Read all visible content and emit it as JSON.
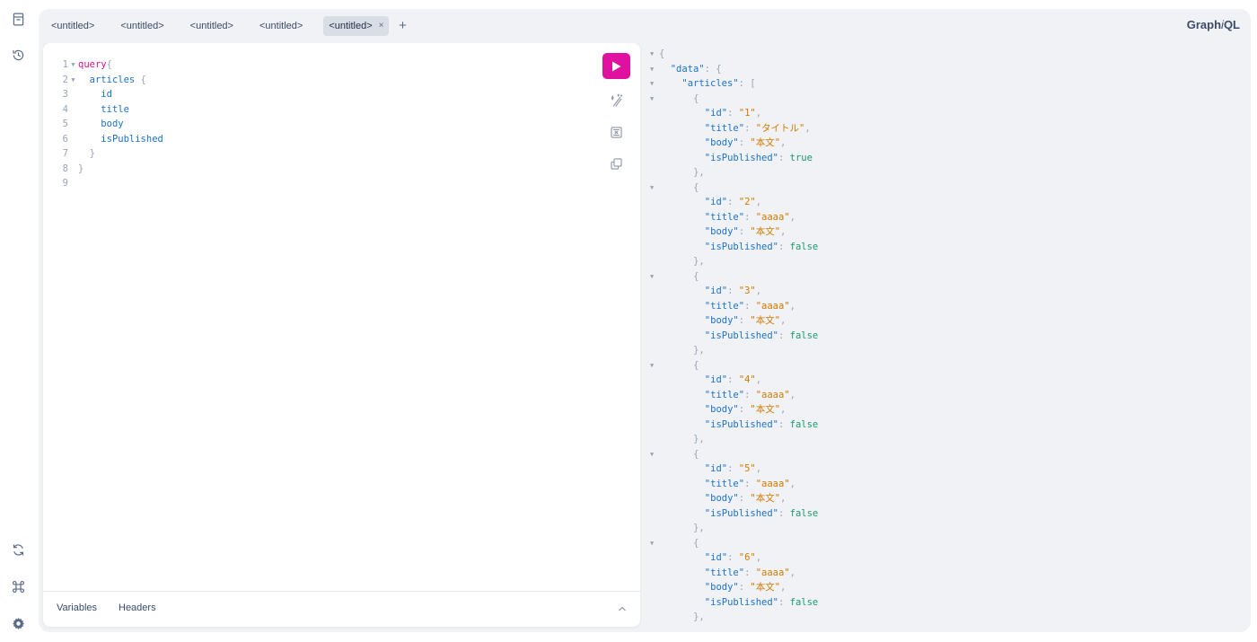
{
  "sidebar": {
    "top_icons": [
      "docs-icon",
      "history-icon"
    ],
    "bottom_icons": [
      "refetch-schema-icon",
      "shortcuts-icon",
      "settings-icon"
    ]
  },
  "tabs": {
    "items": [
      "<untitled>",
      "<untitled>",
      "<untitled>",
      "<untitled>"
    ],
    "active": "<untitled>",
    "close": "×",
    "add": "+"
  },
  "brand": {
    "prefix": "Graph",
    "italic": "i",
    "suffix": "QL"
  },
  "editor": {
    "lines": [
      {
        "n": "1",
        "fold": true,
        "parts": [
          {
            "t": "query",
            "c": "kw"
          },
          {
            "t": "{",
            "c": "pn"
          }
        ]
      },
      {
        "n": "2",
        "fold": true,
        "parts": [
          {
            "t": "  ",
            "c": ""
          },
          {
            "t": "articles",
            "c": "fld"
          },
          {
            "t": " {",
            "c": "pn"
          }
        ]
      },
      {
        "n": "3",
        "fold": false,
        "parts": [
          {
            "t": "    ",
            "c": ""
          },
          {
            "t": "id",
            "c": "fld"
          }
        ]
      },
      {
        "n": "4",
        "fold": false,
        "parts": [
          {
            "t": "    ",
            "c": ""
          },
          {
            "t": "title",
            "c": "fld"
          }
        ]
      },
      {
        "n": "5",
        "fold": false,
        "parts": [
          {
            "t": "    ",
            "c": ""
          },
          {
            "t": "body",
            "c": "fld"
          }
        ]
      },
      {
        "n": "6",
        "fold": false,
        "parts": [
          {
            "t": "    ",
            "c": ""
          },
          {
            "t": "isPublished",
            "c": "fld"
          }
        ]
      },
      {
        "n": "7",
        "fold": false,
        "parts": [
          {
            "t": "  }",
            "c": "pn"
          }
        ]
      },
      {
        "n": "8",
        "fold": false,
        "parts": [
          {
            "t": "}",
            "c": "pn"
          }
        ]
      },
      {
        "n": "9",
        "fold": false,
        "parts": []
      }
    ],
    "bottom_tabs": {
      "variables": "Variables",
      "headers": "Headers"
    }
  },
  "result": {
    "root_open": "{",
    "data_key": "\"data\"",
    "articles_key": "\"articles\"",
    "items": [
      {
        "id": "\"1\"",
        "title": "\"タイトル\"",
        "body": "\"本文\"",
        "isPublished": "true"
      },
      {
        "id": "\"2\"",
        "title": "\"aaaa\"",
        "body": "\"本文\"",
        "isPublished": "false"
      },
      {
        "id": "\"3\"",
        "title": "\"aaaa\"",
        "body": "\"本文\"",
        "isPublished": "false"
      },
      {
        "id": "\"4\"",
        "title": "\"aaaa\"",
        "body": "\"本文\"",
        "isPublished": "false"
      },
      {
        "id": "\"5\"",
        "title": "\"aaaa\"",
        "body": "\"本文\"",
        "isPublished": "false"
      },
      {
        "id": "\"6\"",
        "title": "\"aaaa\"",
        "body": "\"本文\"",
        "isPublished": "false"
      }
    ]
  },
  "colors": {
    "accent": "#e0119f",
    "keyword": "#d4148f",
    "field": "#1c72c9",
    "string": "#d47a00",
    "boolean": "#1d9a6c"
  }
}
